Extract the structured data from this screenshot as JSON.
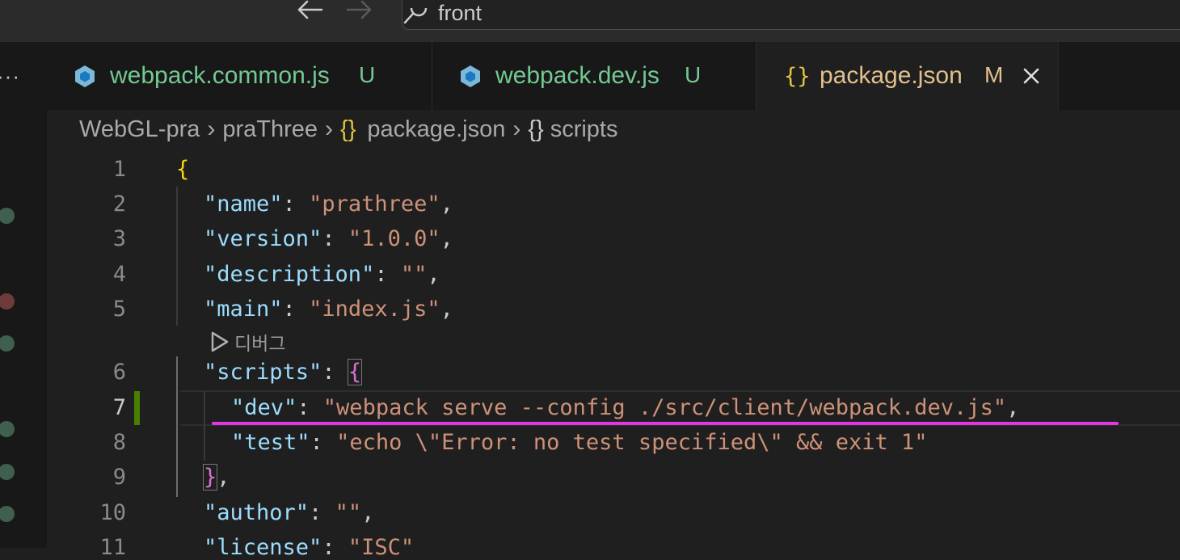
{
  "titlebar": {
    "back_icon": "arrow-left-icon",
    "forward_icon": "arrow-right-icon",
    "command_center": {
      "icon": "search-icon",
      "text": "front"
    }
  },
  "activity_bar": {
    "more_icon": "ellipsis-icon",
    "more_text": "···"
  },
  "tabs": [
    {
      "label": "webpack.common.js",
      "badge": "U",
      "icon": "webpack-icon",
      "color": "#73c991",
      "active": false
    },
    {
      "label": "webpack.dev.js",
      "badge": "U",
      "icon": "webpack-icon",
      "color": "#73c991",
      "active": false
    },
    {
      "label": "package.json",
      "badge": "M",
      "icon": "json-braces-icon",
      "icon_text": "{}",
      "color": "#e2c08d",
      "active": true,
      "close_icon": "close-icon"
    }
  ],
  "breadcrumb": {
    "items": [
      "WebGL-pra",
      "praThree",
      "package.json",
      "scripts"
    ],
    "file_icon_text": "{}",
    "symbol_icon_text": "{}"
  },
  "codelens": {
    "icon": "play-icon",
    "text": "디버그"
  },
  "code": {
    "line_numbers": [
      "1",
      "2",
      "3",
      "4",
      "5",
      "6",
      "7",
      "8",
      "9",
      "10",
      "11"
    ],
    "active_line": "7",
    "lines": {
      "l1": {
        "brace": "{"
      },
      "l2": {
        "key": "\"name\"",
        "colon": ": ",
        "value": "\"prathree\"",
        "comma": ","
      },
      "l3": {
        "key": "\"version\"",
        "colon": ": ",
        "value": "\"1.0.0\"",
        "comma": ","
      },
      "l4": {
        "key": "\"description\"",
        "colon": ": ",
        "value": "\"\"",
        "comma": ","
      },
      "l5": {
        "key": "\"main\"",
        "colon": ": ",
        "value": "\"index.js\"",
        "comma": ","
      },
      "l6": {
        "key": "\"scripts\"",
        "colon": ": ",
        "brace": "{"
      },
      "l7": {
        "key": "\"dev\"",
        "colon": ": ",
        "value": "\"webpack serve --config ./src/client/webpack.dev.js\"",
        "comma": ","
      },
      "l8": {
        "key": "\"test\"",
        "colon": ": ",
        "value": "\"echo \\\"Error: no test specified\\\" && exit 1\""
      },
      "l9": {
        "brace": "}",
        "comma": ","
      },
      "l10": {
        "key": "\"author\"",
        "colon": ": ",
        "value": "\"\"",
        "comma": ","
      },
      "l11": {
        "key": "\"license\"",
        "colon": ": ",
        "value": "\"ISC\""
      }
    }
  },
  "colors": {
    "untracked": "#73c991",
    "modified": "#e2c08d",
    "underline": "#e536e5",
    "dirty_gutter": "#487e02",
    "key": "#9cdcfe",
    "string": "#ce9178"
  }
}
